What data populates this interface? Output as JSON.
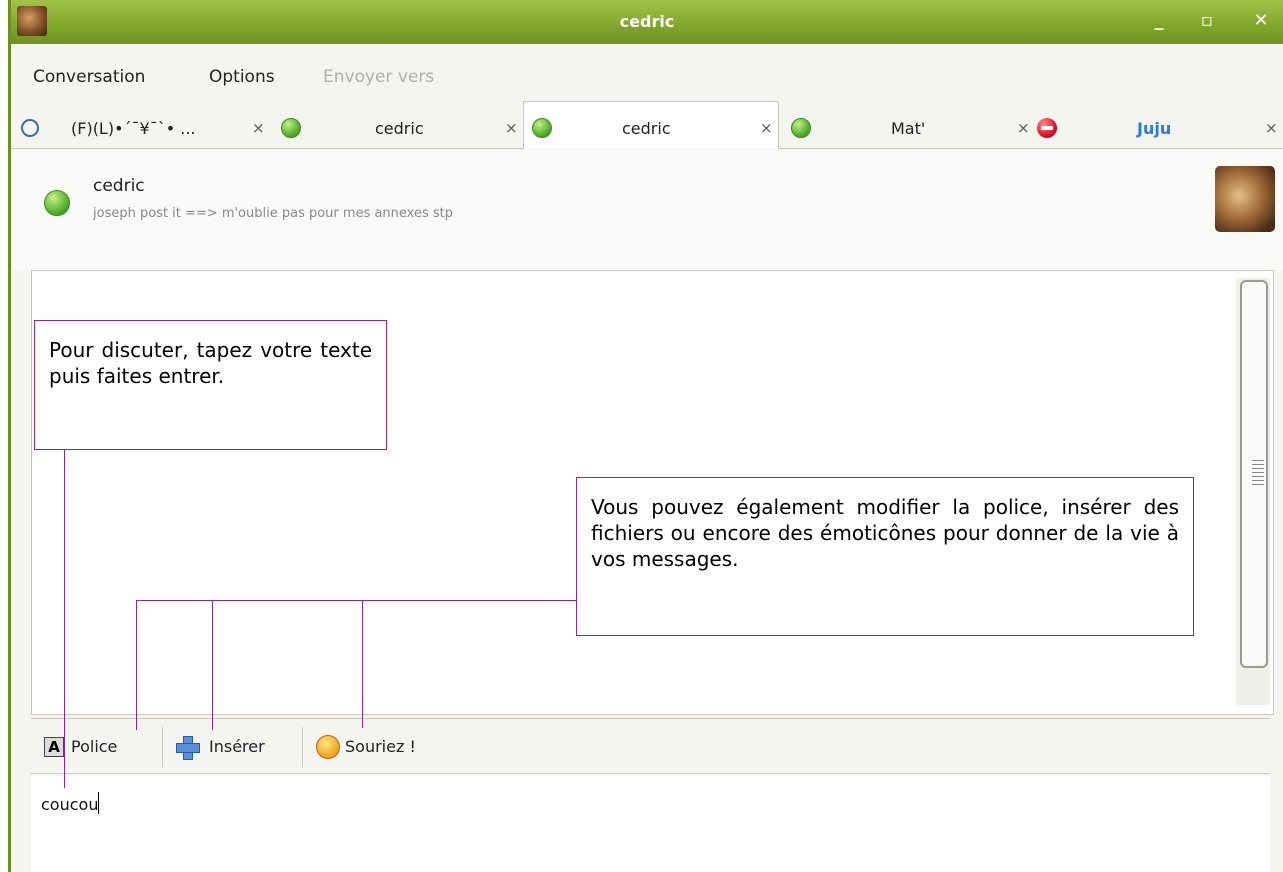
{
  "window": {
    "title": "cedric"
  },
  "menu": {
    "conversation": "Conversation",
    "options": "Options",
    "send_to": "Envoyer vers"
  },
  "tabs": [
    {
      "label": "(F)(L)•´¯¥¯`• ...",
      "icon": "clock-icon"
    },
    {
      "label": "cedric",
      "status": "online"
    },
    {
      "label": "cedric",
      "status": "online",
      "active": true
    },
    {
      "label": "Mat'",
      "status": "online"
    },
    {
      "label": "Juju",
      "status": "busy",
      "color": "#2a7ae0"
    }
  ],
  "tab_close": "×",
  "contact": {
    "name": "cedric",
    "personal_message": "joseph post it ==> m'oublie pas pour mes annexes stp"
  },
  "toolbar": {
    "font_label": "Police",
    "insert_label": "Insérer",
    "smiley_label": "Souriez !"
  },
  "input": {
    "value": "coucou"
  },
  "callouts": {
    "chat": "Pour discuter, tapez votre texte puis faites entrer.",
    "tools": "Vous pouvez également modifier la police, insérer des fichiers ou encore des émoticônes pour donner de la vie à vos messages."
  },
  "colors": {
    "titlebar": "#85aa2e",
    "callout_border": "#8a2a8a",
    "busy_tab_text": "#2a7ae0"
  }
}
